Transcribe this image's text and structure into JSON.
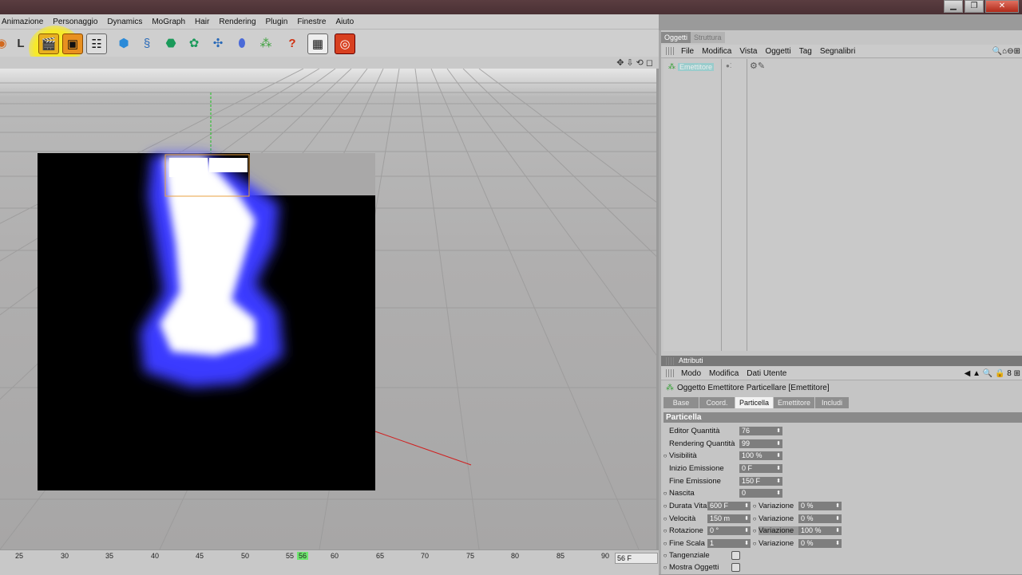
{
  "window": {
    "minimize": "▁",
    "restore": "❐",
    "close": "✕"
  },
  "menu": [
    "Animazione",
    "Personaggio",
    "Dynamics",
    "MoGraph",
    "Hair",
    "Rendering",
    "Plugin",
    "Finestre",
    "Aiuto"
  ],
  "toolbar_icons": [
    "snap-icon",
    "axis-icon",
    "render-view-icon",
    "render-picture-queue-icon",
    "render-settings-icon",
    "cube-icon",
    "spline-icon",
    "nurbs-icon",
    "array-icon",
    "deformer-icon",
    "scene-icon",
    "particles-icon",
    "help-icon",
    "viewport-settings-icon",
    "cinema-icon"
  ],
  "timeline": {
    "ticks": [
      "25",
      "30",
      "35",
      "40",
      "45",
      "50",
      "55",
      "56",
      "60",
      "65",
      "70",
      "75",
      "80",
      "85",
      "90"
    ],
    "frame": "56 F"
  },
  "objects_panel": {
    "tabs": [
      "Oggetti",
      "Struttura"
    ],
    "menu": [
      "File",
      "Modifica",
      "Vista",
      "Oggetti",
      "Tag",
      "Segnalibri"
    ],
    "rows": [
      {
        "name": "Emettitore"
      }
    ]
  },
  "attributes": {
    "header": "Attributi",
    "menu": [
      "Modo",
      "Modifica",
      "Dati Utente"
    ],
    "object_title": "Oggetto Emettitore Particellare [Emettitore]",
    "tabs": [
      "Base",
      "Coord.",
      "Particella",
      "Emettitore",
      "Includi"
    ],
    "selected_tab": "Particella",
    "section": "Particella",
    "params": [
      {
        "label": "Editor Quantità",
        "value": "76",
        "anim": false
      },
      {
        "label": "Rendering Quantità",
        "value": "99",
        "anim": false
      },
      {
        "label": "Visibilità",
        "value": "100 %",
        "anim": true
      },
      {
        "label": "Inizio Emissione",
        "value": "0 F",
        "anim": false
      },
      {
        "label": "Fine Emissione",
        "value": "150 F",
        "anim": false
      },
      {
        "label": "Nascita",
        "value": "0",
        "anim": true
      }
    ],
    "pair_params": [
      {
        "label": "Durata Vita",
        "value": "600 F",
        "var_label": "Variazione",
        "var_value": "0 %"
      },
      {
        "label": "Velocità",
        "value": "150 m",
        "var_label": "Variazione",
        "var_value": "0 %"
      },
      {
        "label": "Rotazione",
        "value": "0 °",
        "var_label": "Variazione",
        "var_value": "100 %"
      },
      {
        "label": "Fine Scala",
        "value": "1",
        "var_label": "Variazione",
        "var_value": "0 %"
      }
    ],
    "checks": [
      {
        "label": "Tangenziale"
      },
      {
        "label": "Mostra Oggetti"
      }
    ]
  },
  "colors": {
    "highlight": "#f7ea2a",
    "flame_core": "#ffffff",
    "flame_edge": "#3b3bff"
  }
}
